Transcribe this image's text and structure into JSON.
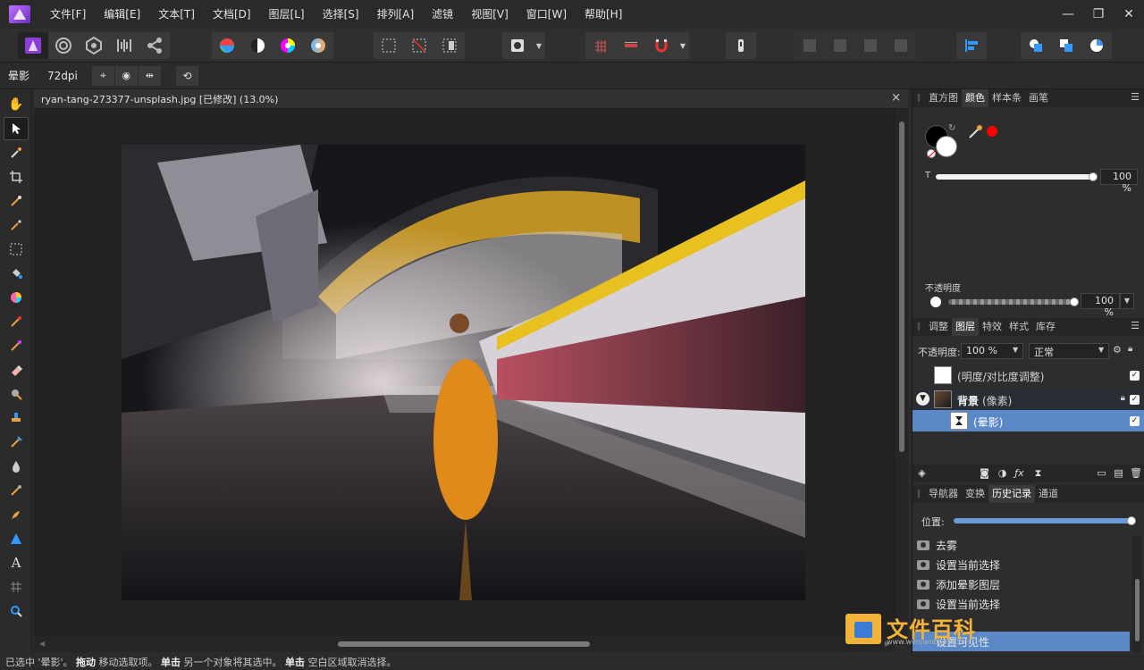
{
  "menubar": {
    "items": [
      "文件[F]",
      "编辑[E]",
      "文本[T]",
      "文档[D]",
      "图层[L]",
      "选择[S]",
      "排列[A]",
      "滤镜",
      "视图[V]",
      "窗口[W]",
      "帮助[H]"
    ],
    "window_controls": [
      "—",
      "❐",
      "✕"
    ]
  },
  "context": {
    "tool_name": "晕影",
    "dpi": "72dpi"
  },
  "document": {
    "title": "ryan-tang-273377-unsplash.jpg [已修改] (13.0%)",
    "close": "×"
  },
  "color_panel": {
    "tabs": [
      "直方图",
      "颜色",
      "样本条",
      "画笔"
    ],
    "active_tab": "颜色",
    "t_label": "T",
    "t_value": "100 %",
    "opacity_label": "不透明度",
    "opacity_value": "100 %",
    "accent_color": "#ff0000"
  },
  "layers_panel": {
    "tabs": [
      "调整",
      "图层",
      "特效",
      "样式",
      "库存"
    ],
    "active_tab": "图层",
    "opacity_label": "不透明度:",
    "opacity_value": "100 %",
    "blend_mode": "正常",
    "layers": [
      {
        "name": "(明度/对比度调整)",
        "checked": "✓"
      },
      {
        "name": "背景",
        "suffix": "(像素)",
        "checked": "✓"
      },
      {
        "name": "(晕影)",
        "checked": "✓"
      }
    ]
  },
  "history_panel": {
    "tabs": [
      "导航器",
      "变换",
      "历史记录",
      "通道"
    ],
    "active_tab": "历史记录",
    "position_label": "位置:",
    "entries": [
      "去雾",
      "设置当前选择",
      "添加晕影图层",
      "设置当前选择",
      "设置可见性"
    ]
  },
  "statusbar": {
    "part1": "已选中 '晕影'。",
    "drag_bold": "拖动",
    "part2": " 移动选取项。",
    "click_bold": "单击",
    "part3": " 另一个对象将其选中。",
    "click2_bold": "单击",
    "part4": " 空白区域取消选择。"
  },
  "watermark": {
    "text": "文件百科",
    "url": "www.wenjianbaike.com"
  },
  "colors": {
    "selection": "#5b88c7",
    "brand": "#8a3fd6",
    "watermark": "#f2b338"
  }
}
